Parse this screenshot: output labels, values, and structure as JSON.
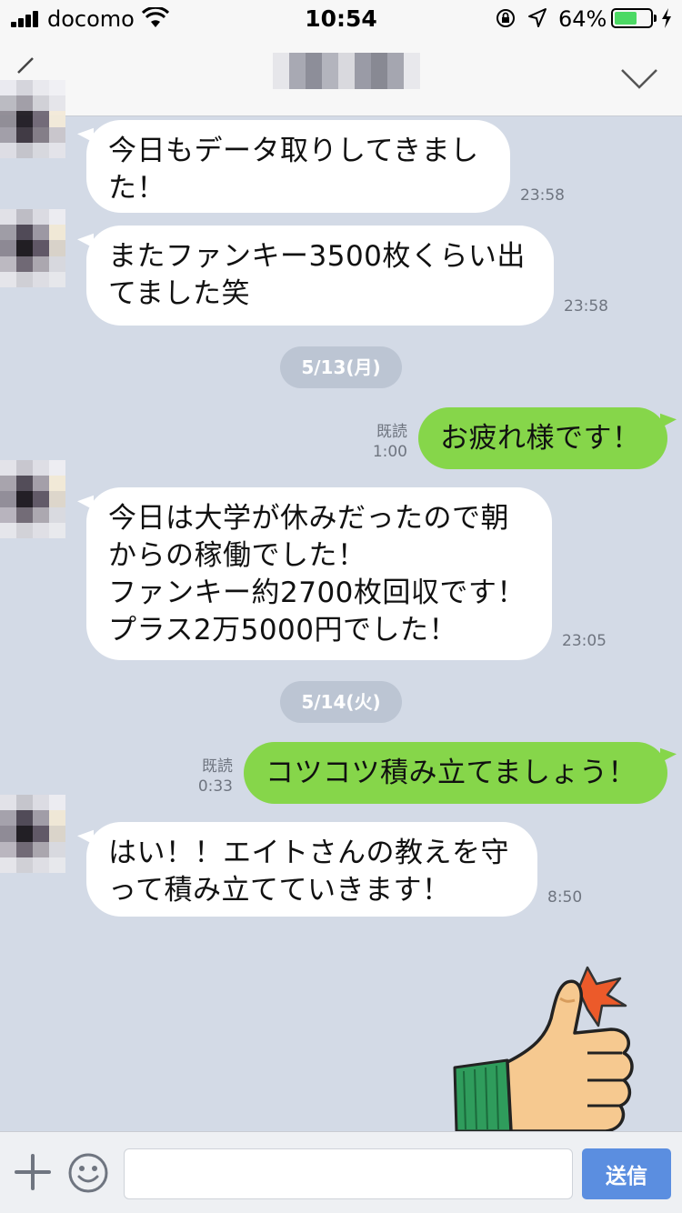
{
  "status_bar": {
    "carrier": "docomo",
    "time": "10:54",
    "battery_percent": "64%",
    "battery_level": 0.64,
    "icons": [
      "signal-icon",
      "wifi-icon",
      "rotation-lock-icon",
      "location-icon",
      "battery-icon",
      "charging-icon"
    ]
  },
  "header": {
    "icons": [
      "back-icon",
      "menu-chevron-icon"
    ]
  },
  "messages": [
    {
      "side": "in",
      "lines": [
        "今日もデータ取りしてきまし",
        "た！"
      ],
      "time": "23:58"
    },
    {
      "side": "in",
      "lines": [
        "またファンキー3500枚くらい出",
        "てました笑"
      ],
      "time": "23:58"
    },
    {
      "type": "date",
      "label": "5/13(月)"
    },
    {
      "side": "out",
      "lines": [
        "お疲れ様です！"
      ],
      "read": "既読",
      "time": "1:00"
    },
    {
      "side": "in",
      "lines": [
        "今日は大学が休みだったので朝",
        "からの稼働でした！",
        "ファンキー約2700枚回収です！",
        "プラス2万5000円でした！"
      ],
      "time": "23:05"
    },
    {
      "type": "date",
      "label": "5/14(火)"
    },
    {
      "side": "out",
      "lines": [
        "コツコツ積み立てましょう！"
      ],
      "read": "既読",
      "time": "0:33"
    },
    {
      "side": "in",
      "lines": [
        "はい！！エイトさんの教えを守",
        "って積み立てていきます！"
      ],
      "time": "8:50"
    }
  ],
  "sticker": {
    "name": "thumbs-up-sticker"
  },
  "footer": {
    "input_value": "",
    "input_placeholder": "",
    "send_label": "送信",
    "icons": [
      "plus-icon",
      "smile-icon"
    ]
  },
  "colors": {
    "chat_bg": "#d3dae6",
    "incoming_bubble": "#ffffff",
    "outgoing_bubble": "#86d64a",
    "date_pill": "#bcc5d3",
    "send_button": "#5b8ee0",
    "battery_fill": "#4cd964"
  }
}
